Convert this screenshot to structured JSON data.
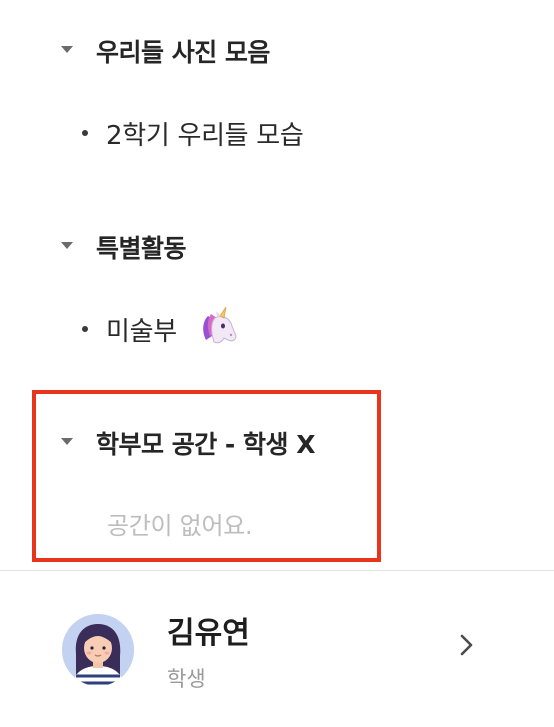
{
  "sections": [
    {
      "title": "우리들 사진 모음",
      "items": [
        {
          "label": "2학기 우리들 모습"
        }
      ]
    },
    {
      "title": "특별활동",
      "items": [
        {
          "label": "미술부"
        }
      ]
    },
    {
      "title": "학부모 공간 - 학생 X",
      "empty_message": "공간이 없어요."
    }
  ],
  "profile": {
    "name": "김유연",
    "role": "학생"
  },
  "colors": {
    "highlight_border": "#e8341c",
    "title_text": "#262626",
    "muted_text": "#bdbdbd",
    "role_text": "#9a9a9a",
    "divider": "#e3e3e3"
  },
  "icons": {
    "section_toggle": "caret-down-icon",
    "item_emoji": "unicorn-icon",
    "profile_nav": "chevron-right-icon"
  }
}
